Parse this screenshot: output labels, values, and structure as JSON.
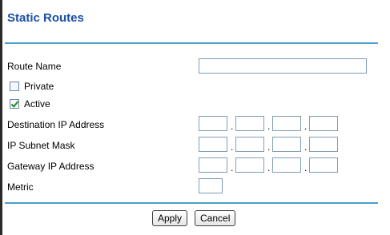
{
  "page": {
    "title": "Static Routes"
  },
  "form": {
    "route_name": {
      "label": "Route Name",
      "value": ""
    },
    "private": {
      "label": "Private",
      "checked": false
    },
    "active": {
      "label": "Active",
      "checked": true
    },
    "destination_ip": {
      "label": "Destination IP Address",
      "octets": [
        "",
        "",
        "",
        ""
      ]
    },
    "subnet_mask": {
      "label": "IP Subnet Mask",
      "octets": [
        "",
        "",
        "",
        ""
      ]
    },
    "gateway_ip": {
      "label": "Gateway IP Address",
      "octets": [
        "",
        "",
        "",
        ""
      ]
    },
    "metric": {
      "label": "Metric",
      "value": ""
    },
    "separator": "."
  },
  "buttons": {
    "apply": "Apply",
    "cancel": "Cancel"
  }
}
